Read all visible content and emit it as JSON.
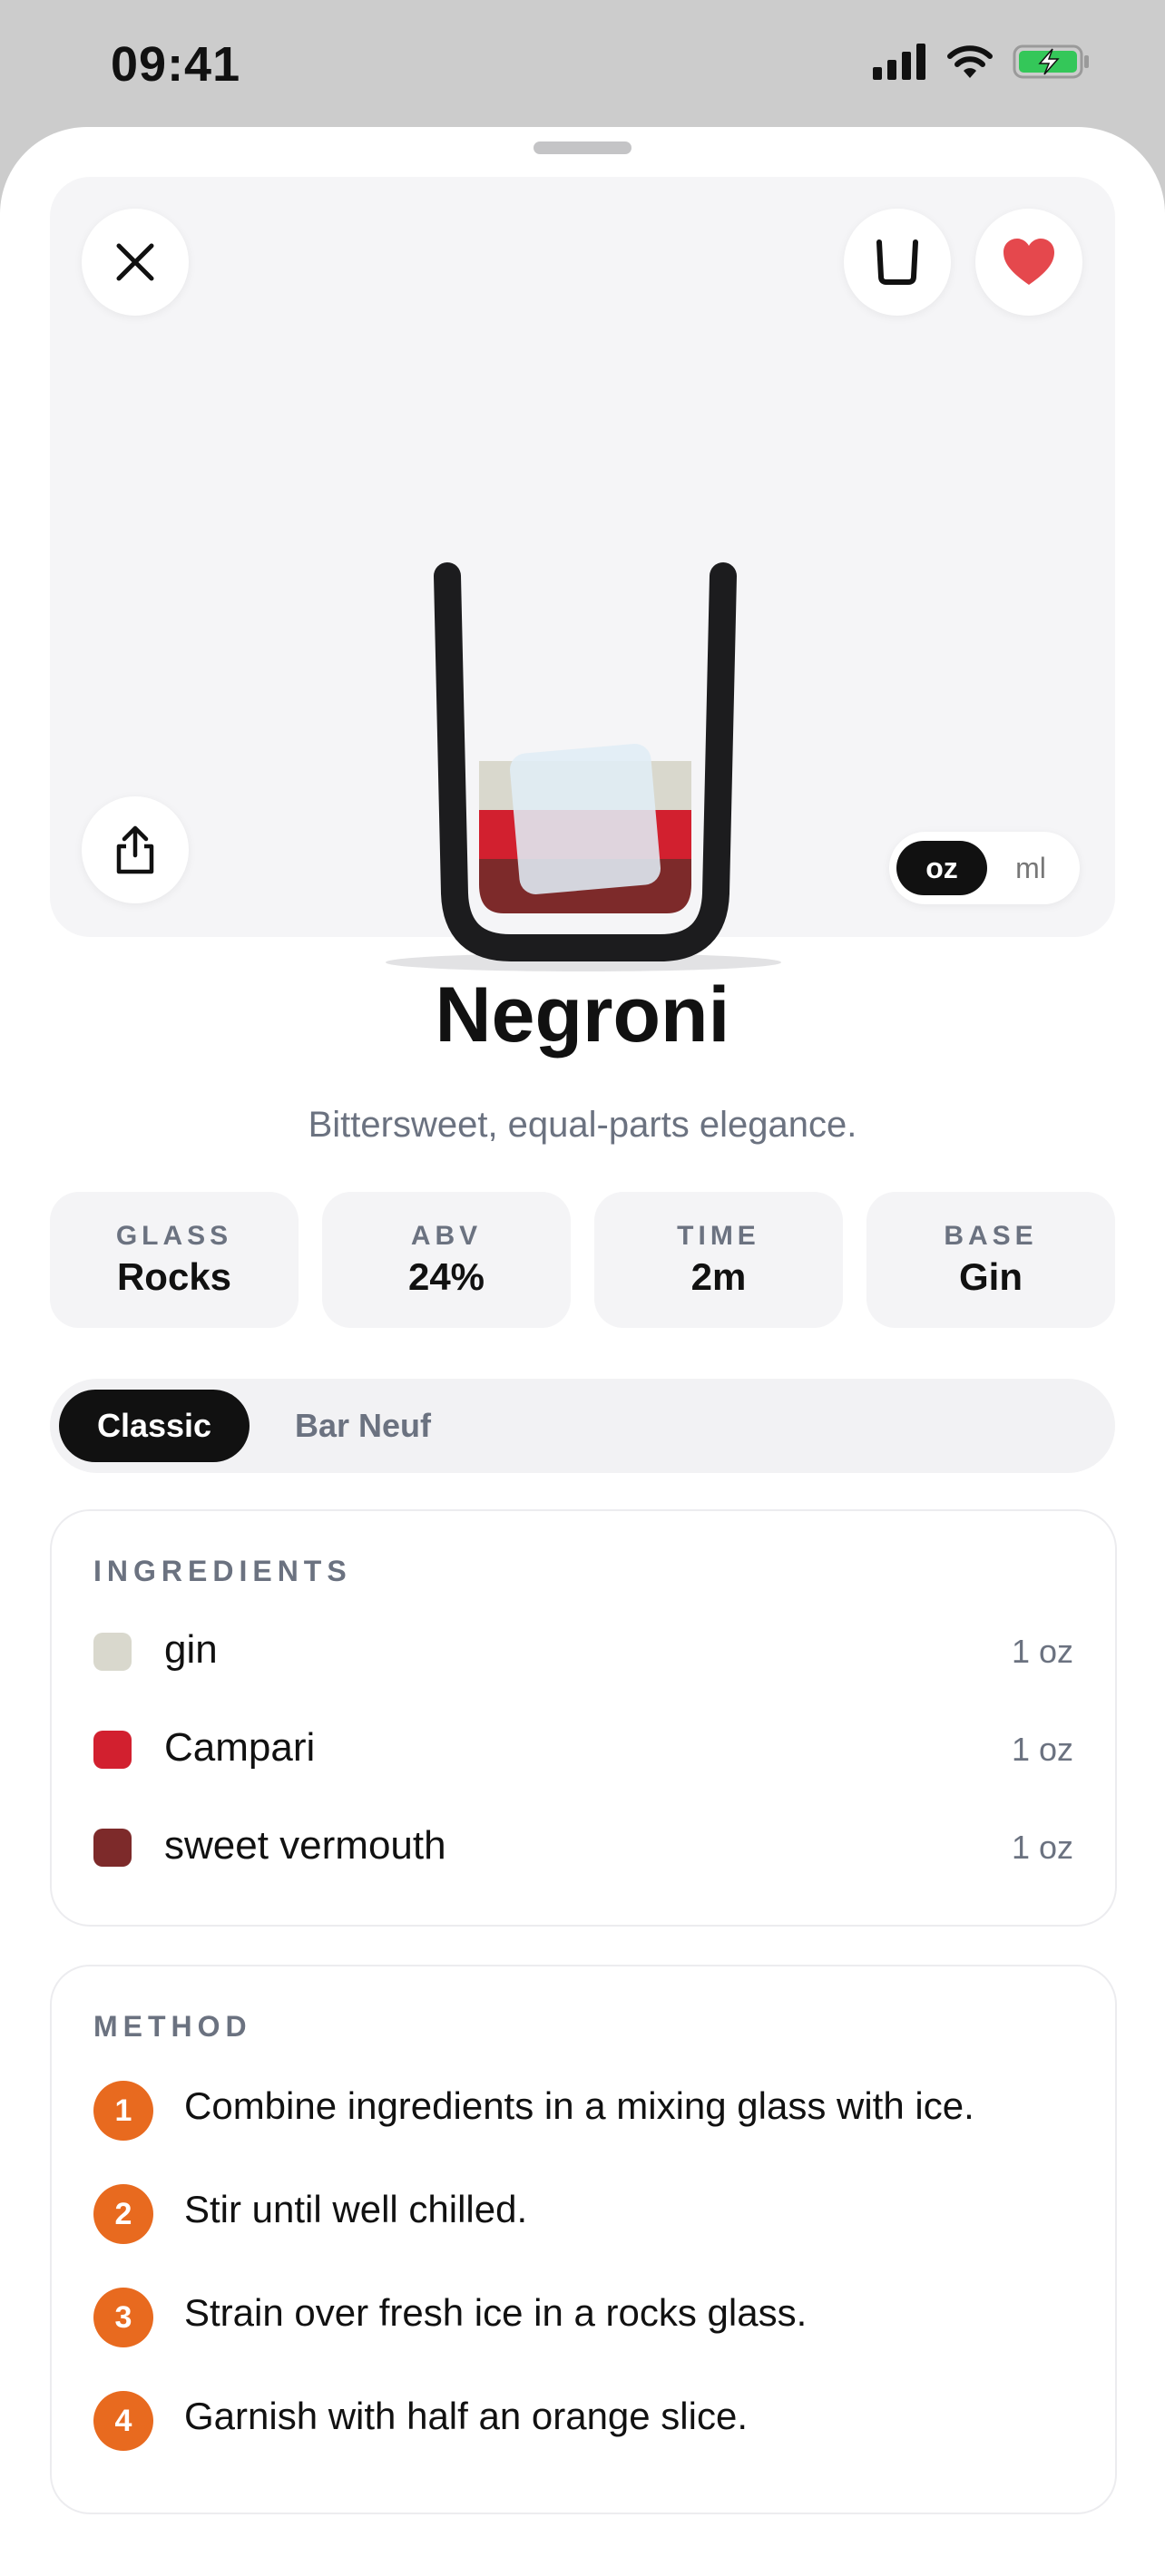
{
  "status": {
    "time": "09:41"
  },
  "hero": {
    "unit_toggle": {
      "selected": "oz",
      "other": "ml"
    }
  },
  "drink": {
    "name": "Negroni",
    "tagline": "Bittersweet, equal-parts elegance."
  },
  "stats": [
    {
      "label": "GLASS",
      "value": "Rocks"
    },
    {
      "label": "ABV",
      "value": "24%"
    },
    {
      "label": "TIME",
      "value": "2m"
    },
    {
      "label": "BASE",
      "value": "Gin"
    }
  ],
  "variants": {
    "selected": "Classic",
    "other": "Bar Neuf"
  },
  "ingredients": {
    "heading": "INGREDIENTS",
    "items": [
      {
        "name": "gin",
        "amount": "1 oz",
        "color": "#d9d8cd"
      },
      {
        "name": "Campari",
        "amount": "1 oz",
        "color": "#d2202f"
      },
      {
        "name": "sweet vermouth",
        "amount": "1 oz",
        "color": "#7d2a2a"
      }
    ]
  },
  "method": {
    "heading": "METHOD",
    "steps": [
      {
        "num": "1",
        "text": "Combine ingredients in a mixing glass with ice."
      },
      {
        "num": "2",
        "text": "Stir until well chilled."
      },
      {
        "num": "3",
        "text": "Strain over fresh ice in a rocks glass."
      },
      {
        "num": "4",
        "text": "Garnish with half an orange slice."
      }
    ]
  },
  "colors": {
    "accent": "#e86a1f",
    "favorite": "#e5484d"
  }
}
